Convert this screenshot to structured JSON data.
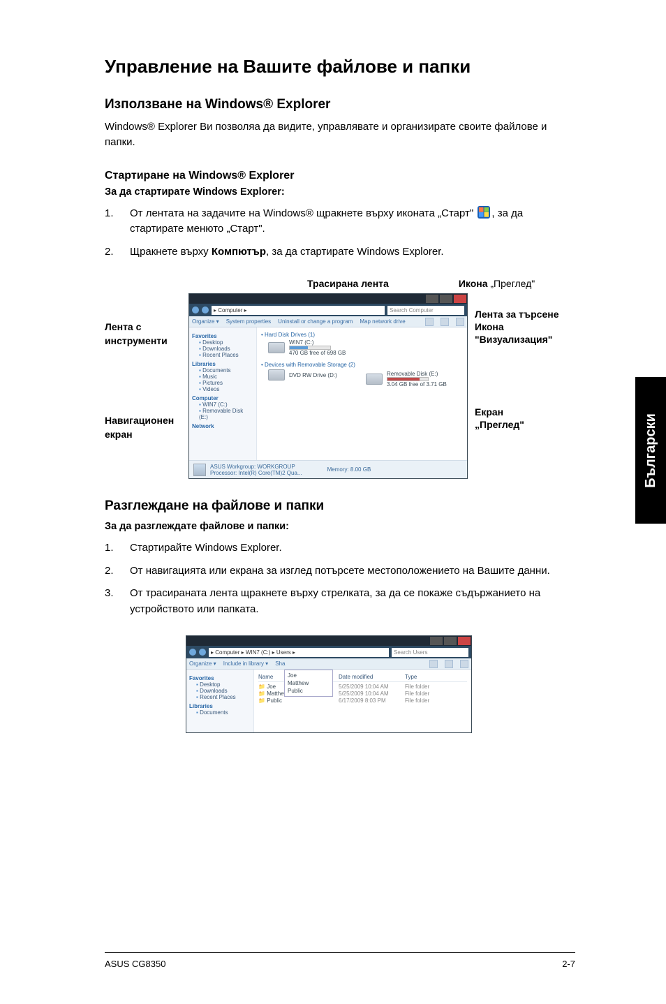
{
  "headings": {
    "h1": "Управление на Вашите файлове и папки",
    "h2a": "Използване на Windows® Explorer",
    "intro": "Windows® Explorer Ви позволяа да видите, управлявате и организирате своите файлове и папки.",
    "h3a": "Стартиране на Windows® Explorer",
    "boldA": "За да стартирате Windows Explorer:",
    "h2b": "Разглеждане на файлове и папки",
    "boldB": "За да разглеждате файлове и папки:"
  },
  "listA": {
    "i1_pre": "От лентата на задачите на Windows® щракнете върху иконата „Старт\" ",
    "i1_post": ", за да стартирате менюто „Старт\".",
    "i2_a": "Щракнете върху ",
    "i2_b": "Компютър",
    "i2_c": ", за да стартирате Windows Explorer."
  },
  "diagramLabels": {
    "topBreadcrumb": "Трасирана лента",
    "topPreviewIcon_a": "Икона ",
    "topPreviewIcon_b": "„Преглед\"",
    "leftToolbar_a": "Лента с",
    "leftToolbar_b": "инструменти",
    "leftNav_a": "Навигационен",
    "leftNav_b": "екран",
    "rightSearch": "Лента за търсене",
    "rightViewIcon_a": "Икона",
    "rightViewIcon_b": "\"Визуализация\"",
    "rightPreview_a": "Екран",
    "rightPreview_b": "„Преглед\""
  },
  "explorerMock": {
    "addr": "▸ Computer ▸",
    "searchPh": "Search Computer",
    "tb_organize": "Organize ▾",
    "tb_sysprops": "System properties",
    "tb_uninstall": "Uninstall or change a program",
    "tb_map": "Map network drive",
    "nav_fav": "Favorites",
    "nav_desktop": "Desktop",
    "nav_downloads": "Downloads",
    "nav_recent": "Recent Places",
    "nav_lib": "Libraries",
    "nav_docs": "Documents",
    "nav_music": "Music",
    "nav_pic": "Pictures",
    "nav_vid": "Videos",
    "nav_comp": "Computer",
    "nav_c": "WIN7 (C:)",
    "nav_rem": "Removable Disk (E:)",
    "nav_net": "Network",
    "main_hdd_hdr": "• Hard Disk Drives (1)",
    "main_hdd_name": "WIN7 (C:)",
    "main_hdd_free": "470 GB free of 698 GB",
    "main_dev_hdr": "• Devices with Removable Storage (2)",
    "main_dvd_name": "DVD RW Drive (D:)",
    "main_rem_name": "Removable Disk (E:)",
    "main_rem_free": "3.04 GB free of 3.71 GB",
    "status_a": "ASUS  Workgroup: WORKGROUP",
    "status_b": "Memory: 8.00 GB",
    "status_c": "Processor: Intel(R) Core(TM)2 Qua..."
  },
  "listB": {
    "i1": "Стартирайте Windows Explorer.",
    "i2": "От навигацията или екрана за изглед потърсете местоположението на Вашите данни.",
    "i3": "От трасираната лента щракнете върху стрелката, за да се покаже съдържанието на устройството или папката."
  },
  "explorerSmall": {
    "path": "▸ Computer ▸ WIN7 (C:) ▸ Users ▸",
    "searchPh": "Search Users",
    "dd1": "Joe",
    "dd2": "Matthew",
    "dd3": "Public",
    "col_name": "Name",
    "col_date": "Date modified",
    "col_type": "Type",
    "r1n": "Joe",
    "r1d": "5/25/2009 10:04 AM",
    "r1t": "File folder",
    "r2n": "Matthew",
    "r2d": "5/25/2009 10:04 AM",
    "r2t": "File folder",
    "r3n": "Public",
    "r3d": "6/17/2009 8:03 PM",
    "r3t": "File folder"
  },
  "sideTab": "Български",
  "footer": {
    "left": "ASUS CG8350",
    "right": "2-7"
  }
}
